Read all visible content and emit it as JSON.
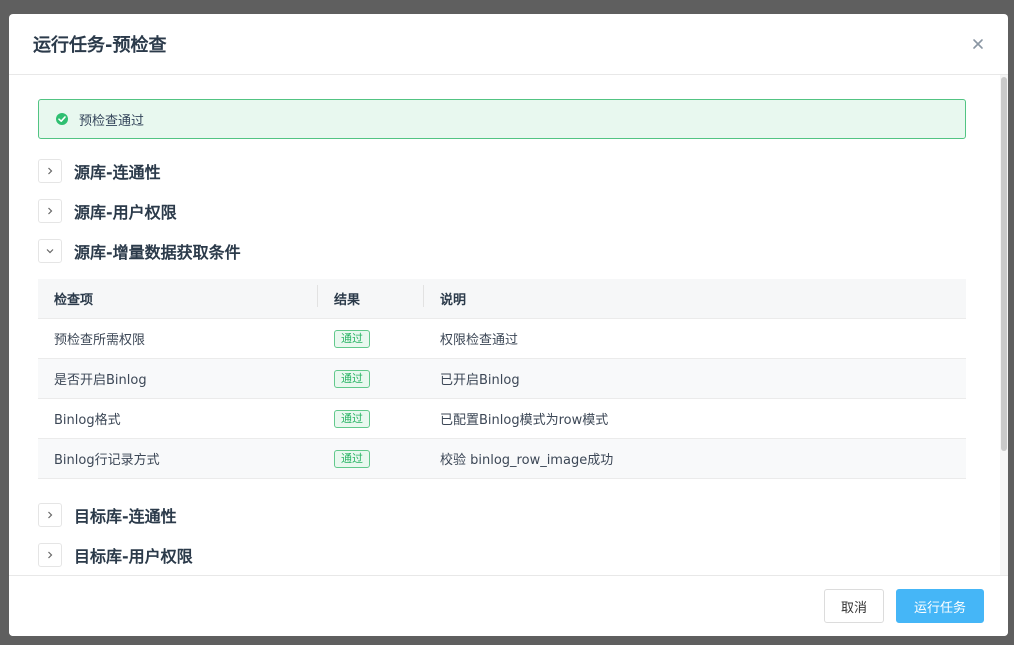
{
  "modal": {
    "title": "运行任务-预检查"
  },
  "alert": {
    "text": "预检查通过",
    "color": "#52c483"
  },
  "sections": [
    {
      "label": "源库-连通性",
      "expanded": false
    },
    {
      "label": "源库-用户权限",
      "expanded": false
    },
    {
      "label": "源库-增量数据获取条件",
      "expanded": true
    },
    {
      "label": "目标库-连通性",
      "expanded": false
    },
    {
      "label": "目标库-用户权限",
      "expanded": false
    }
  ],
  "table": {
    "headers": [
      "检查项",
      "结果",
      "说明"
    ],
    "rows": [
      {
        "item": "预检查所需权限",
        "result": "通过",
        "desc": "权限检查通过"
      },
      {
        "item": "是否开启Binlog",
        "result": "通过",
        "desc": "已开启Binlog"
      },
      {
        "item": "Binlog格式",
        "result": "通过",
        "desc": "已配置Binlog模式为row模式"
      },
      {
        "item": "Binlog行记录方式",
        "result": "通过",
        "desc": "校验 binlog_row_image成功"
      }
    ]
  },
  "footer": {
    "cancel_label": "取消",
    "run_label": "运行任务"
  },
  "colors": {
    "primary": "#45b6f7",
    "success": "#28b464"
  }
}
